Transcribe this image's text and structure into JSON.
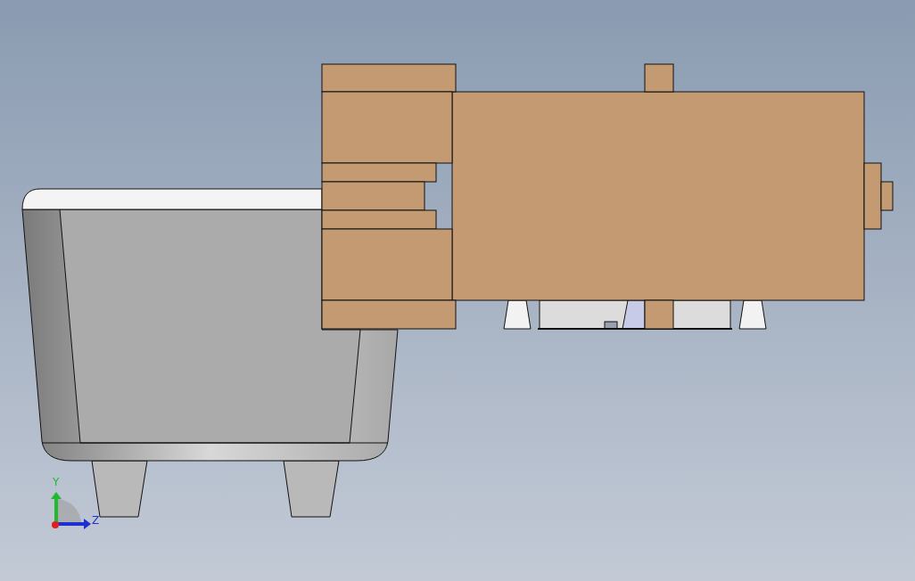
{
  "viewport": {
    "triad": {
      "axes": [
        {
          "label": "Y",
          "color": "#22b830"
        },
        {
          "label": "Z",
          "color": "#1f2fd0"
        }
      ]
    }
  }
}
